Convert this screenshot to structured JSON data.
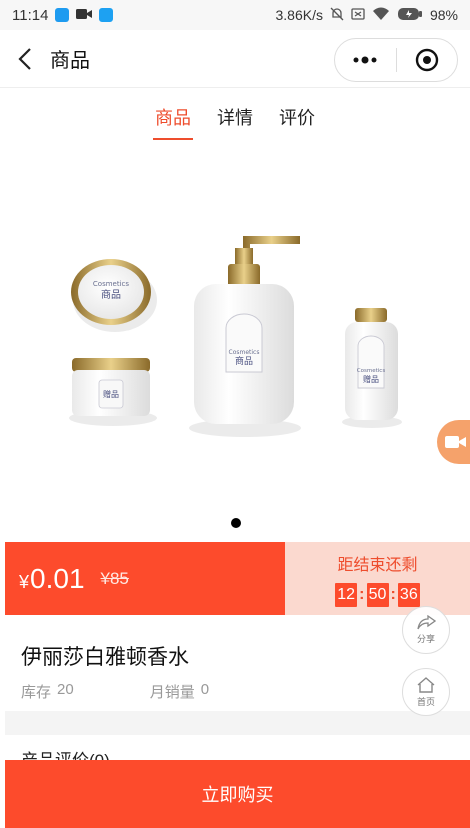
{
  "status_bar": {
    "time": "11:14",
    "network_speed": "3.86K/s",
    "battery": "98%"
  },
  "nav": {
    "title": "商品"
  },
  "tabs": [
    {
      "label": "商品",
      "active": true
    },
    {
      "label": "详情",
      "active": false
    },
    {
      "label": "评价",
      "active": false
    }
  ],
  "product_image": {
    "jar_lid_brand": "Cosmetics",
    "jar_lid_text": "商品",
    "jar_label_text": "赠品",
    "pump_bottle_brand": "Cosmetics",
    "pump_bottle_text": "商品",
    "small_bottle_brand": "Cosmetics",
    "small_bottle_text": "赠品",
    "carousel_pages": 1,
    "carousel_current": 1
  },
  "price": {
    "currency": "¥",
    "amount": "0.01",
    "original": "¥85"
  },
  "countdown": {
    "label": "距结束还剩",
    "hours": "12",
    "minutes": "50",
    "seconds": "36"
  },
  "product": {
    "name": "伊丽莎白雅顿香水",
    "stock_label": "库存",
    "stock_value": "20",
    "sales_label": "月销量",
    "sales_value": "0"
  },
  "float_buttons": {
    "share_label": "分享",
    "home_label": "首页"
  },
  "reviews": {
    "label": "产品评价(0)"
  },
  "buy_button": {
    "label": "立即购买"
  },
  "colors": {
    "accent": "#fd4b2c",
    "countdown_bg": "#fbd9cf",
    "video_fab": "#f5a26b"
  }
}
